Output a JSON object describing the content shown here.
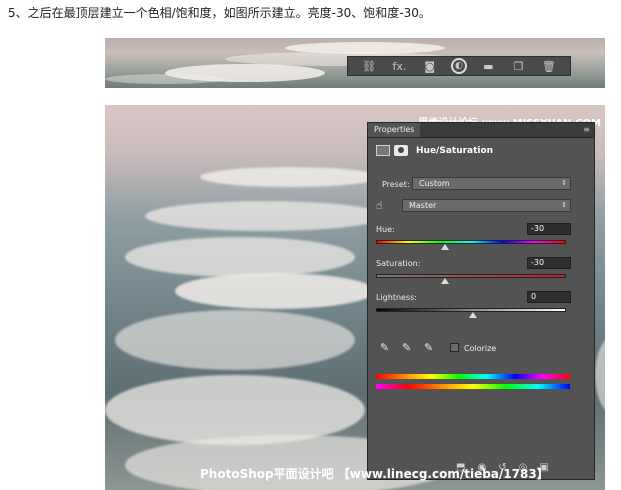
{
  "instruction": "5、之后在最顶层建立一个色相/饱和度，如图所示建立。亮度-30、饱和度-30。",
  "layer_toolbar": {
    "icons": [
      "link-icon",
      "fx-icon",
      "mask-icon",
      "adjustment-layer-icon",
      "folder-icon",
      "new-layer-icon",
      "trash-icon"
    ],
    "fx_label": "fx."
  },
  "properties_panel": {
    "tab_label": "Properties",
    "adjustment_title": "Hue/Saturation",
    "preset_label": "Preset:",
    "preset_value": "Custom",
    "channel_value": "Master",
    "hue_label": "Hue:",
    "hue_value": "-30",
    "saturation_label": "Saturation:",
    "saturation_value": "-30",
    "lightness_label": "Lightness:",
    "lightness_value": "0",
    "colorize_label": "Colorize"
  },
  "watermark_top": "思缘设计论坛 www.MISSYUAN.COM",
  "watermark_bottom": "PhotoShop平面设计吧 【www.linecg.com/tieba/1783】"
}
